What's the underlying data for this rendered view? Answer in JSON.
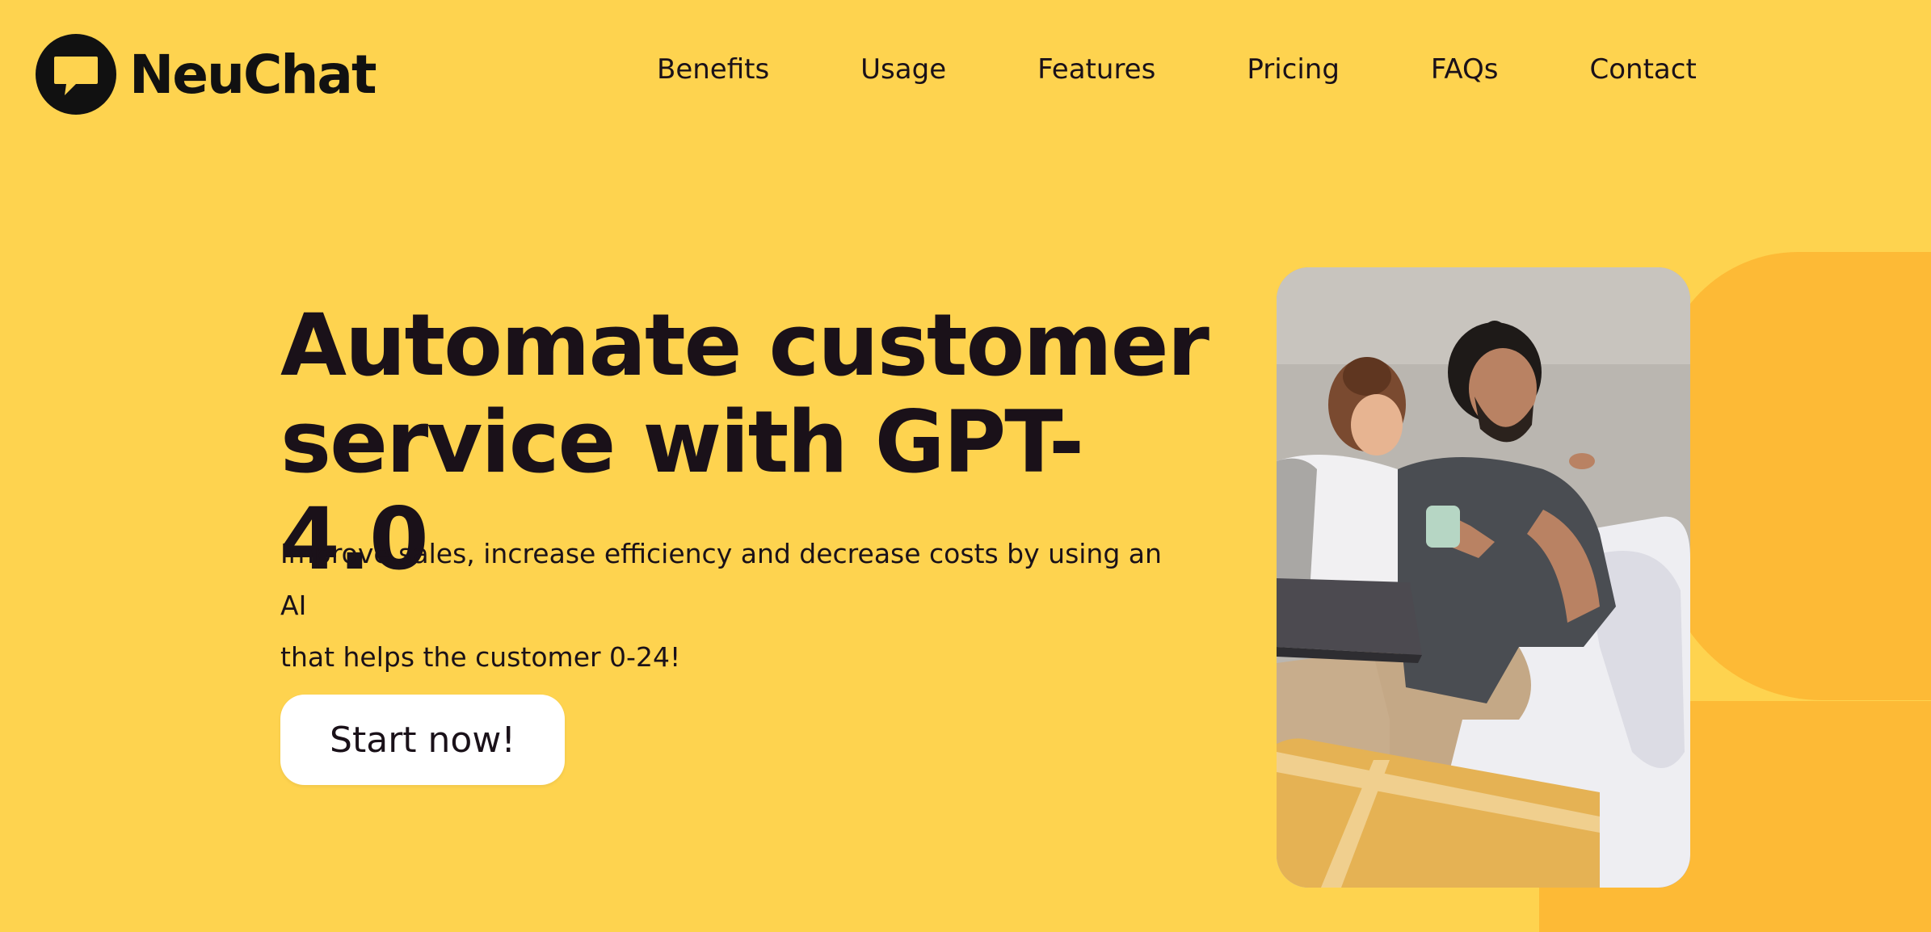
{
  "brand": {
    "name": "NeuChat",
    "logo_icon": "chat-bubble-icon"
  },
  "nav": {
    "items": [
      {
        "label": "Benefits"
      },
      {
        "label": "Usage"
      },
      {
        "label": "Features"
      },
      {
        "label": "Pricing"
      },
      {
        "label": "FAQs"
      },
      {
        "label": "Contact"
      }
    ]
  },
  "hero": {
    "headline_line1": "Automate customer",
    "headline_line2": "service with GPT-4.0",
    "subtitle_line1": "Improve sales, increase efficiency and decrease costs by using an AI",
    "subtitle_line2": "that helps the customer 0-24!",
    "cta_label": "Start now!",
    "image_alt": "Couple sitting on a couch looking at a laptop"
  },
  "colors": {
    "background": "#FED34F",
    "accent_blob": "#FDBA36",
    "text": "#1a1119",
    "button_bg": "#ffffff"
  }
}
